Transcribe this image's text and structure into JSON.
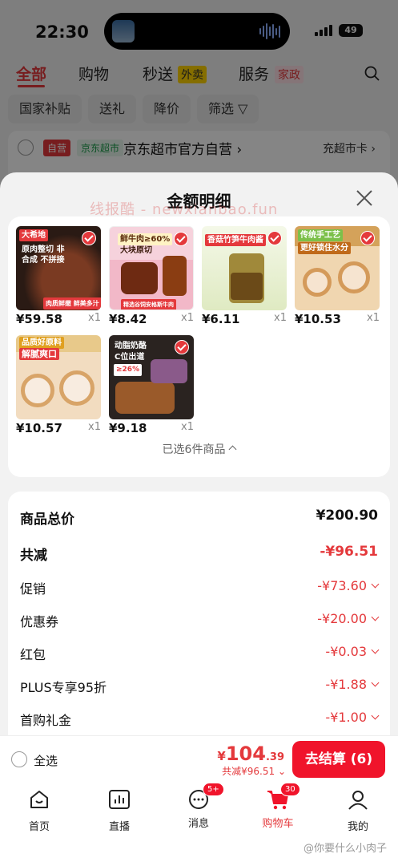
{
  "status_bar": {
    "time": "22:30",
    "battery": "49"
  },
  "top_tabs": [
    {
      "label": "全部",
      "active": true
    },
    {
      "label": "购物",
      "active": false
    },
    {
      "label": "秒送",
      "badge": "外卖",
      "active": false
    },
    {
      "label": "服务",
      "badge": "家政",
      "active": false
    }
  ],
  "filter_chips": [
    "国家补贴",
    "送礼",
    "降价",
    "筛选"
  ],
  "store": {
    "tag_self": "自营",
    "tag_market": "京东超市",
    "name": "京东超市官方自营",
    "card_link": "充超市卡"
  },
  "sheet": {
    "title": "金额明细",
    "watermark": "线报酷 - newxianbao.fun",
    "selected_count": "已选6件商品",
    "items": [
      {
        "price": "¥59.58",
        "qty": "x1",
        "label_top": "大希地",
        "label_main": "原肉整切 非合成 不拼接",
        "label_bottom": "肉质鲜嫩 鲜美多汁"
      },
      {
        "price": "¥8.42",
        "qty": "x1",
        "label_top": "鲜牛肉≥60%",
        "label_main": "大块原切",
        "label_bottom": "精选谷饲安格斯牛肉"
      },
      {
        "price": "¥6.11",
        "qty": "x1",
        "label_top": "香菇竹笋牛肉酱",
        "label_main": "",
        "label_bottom": ""
      },
      {
        "price": "¥10.53",
        "qty": "x1",
        "label_top": "传统手工艺",
        "label_main": "更好锁住水分",
        "label_bottom": ""
      },
      {
        "price": "¥10.57",
        "qty": "x1",
        "label_top": "品质好原料",
        "label_main": "解腻爽口",
        "label_bottom": ""
      },
      {
        "price": "¥9.18",
        "qty": "x1",
        "label_top": "动脂奶酪",
        "label_main": "C位出道",
        "label_bottom": "≥26%"
      }
    ]
  },
  "price_details": {
    "total_label": "商品总价",
    "total_value": "¥200.90",
    "discount_label": "共减",
    "discount_value": "-¥96.51",
    "rows": [
      {
        "label": "促销",
        "value": "-¥73.60"
      },
      {
        "label": "优惠券",
        "value": "-¥20.00"
      },
      {
        "label": "红包",
        "value": "-¥0.03"
      },
      {
        "label": "PLUS专享95折",
        "value": "-¥1.88"
      },
      {
        "label": "首购礼金",
        "value": "-¥1.00"
      }
    ]
  },
  "checkout": {
    "select_all": "全选",
    "currency": "¥",
    "total_int": "104",
    "total_dec": ".39",
    "total_off": "共减¥96.51",
    "button": "去结算 (6)"
  },
  "tabbar": [
    {
      "label": "首页",
      "icon": "home-icon"
    },
    {
      "label": "直播",
      "icon": "live-icon"
    },
    {
      "label": "消息",
      "icon": "message-icon",
      "badge": "5+"
    },
    {
      "label": "购物车",
      "icon": "cart-icon",
      "badge": "30",
      "active": true
    },
    {
      "label": "我的",
      "icon": "profile-icon"
    }
  ],
  "weibo_watermark": "@你要什么小肉子",
  "colors": {
    "accent": "#e4393c",
    "checkout_button": "#f0142b"
  }
}
